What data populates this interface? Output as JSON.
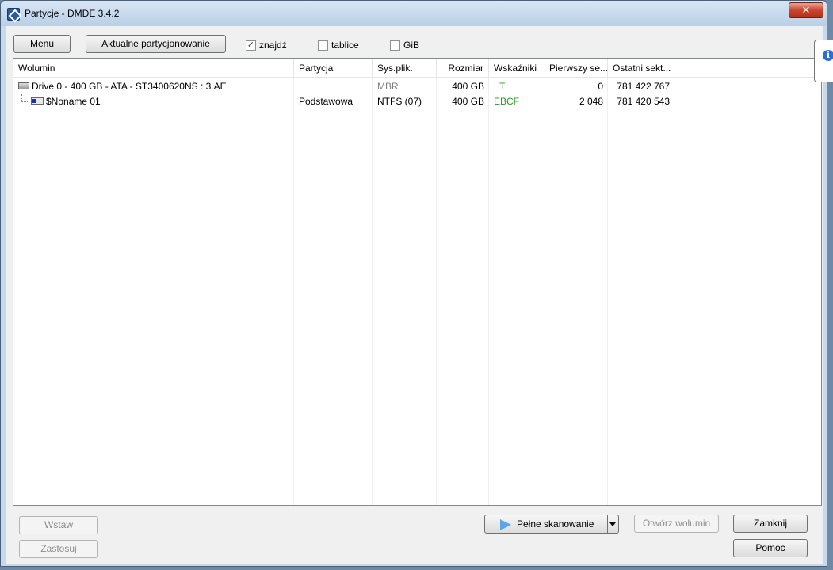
{
  "window": {
    "title": "Partycje - DMDE 3.4.2",
    "close_symbol": "✕"
  },
  "toolbar": {
    "menu_label": "Menu",
    "current_partitioning_label": "Aktualne partycjonowanie",
    "checkboxes": [
      {
        "label": "znajdź",
        "checked": true
      },
      {
        "label": "tablice",
        "checked": false
      },
      {
        "label": "GiB",
        "checked": false
      }
    ]
  },
  "table": {
    "columns": [
      "Wolumin",
      "Partycja",
      "Sys.plik.",
      "Rozmiar",
      "Wskaźniki",
      "Pierwszy se...",
      "Ostatni sekt..."
    ],
    "rows": [
      {
        "volume": "Drive 0 - 400 GB - ATA - ST3400620NS : 3.AE",
        "partition": "",
        "fs": "MBR",
        "size": "400 GB",
        "flags": "T",
        "first": "0",
        "last": "781 422 767",
        "icon": "hard-drive-icon"
      },
      {
        "volume": "$Noname 01",
        "partition": "Podstawowa",
        "fs": "NTFS (07)",
        "size": "400 GB",
        "flags": "EBCF",
        "first": "2 048",
        "last": "781 420 543",
        "icon": "partition-icon"
      }
    ]
  },
  "buttons": {
    "insert": "Wstaw",
    "apply": "Zastosuj",
    "full_scan": "Pełne skanowanie",
    "open_volume": "Otwórz wolumin",
    "close": "Zamknij",
    "help": "Pomoc"
  },
  "colors": {
    "flags_green": "#1ea01e",
    "grey_text": "#808080",
    "close_red": "#c9452e"
  },
  "balloon": {
    "icon": "info-icon",
    "symbol": "i"
  }
}
